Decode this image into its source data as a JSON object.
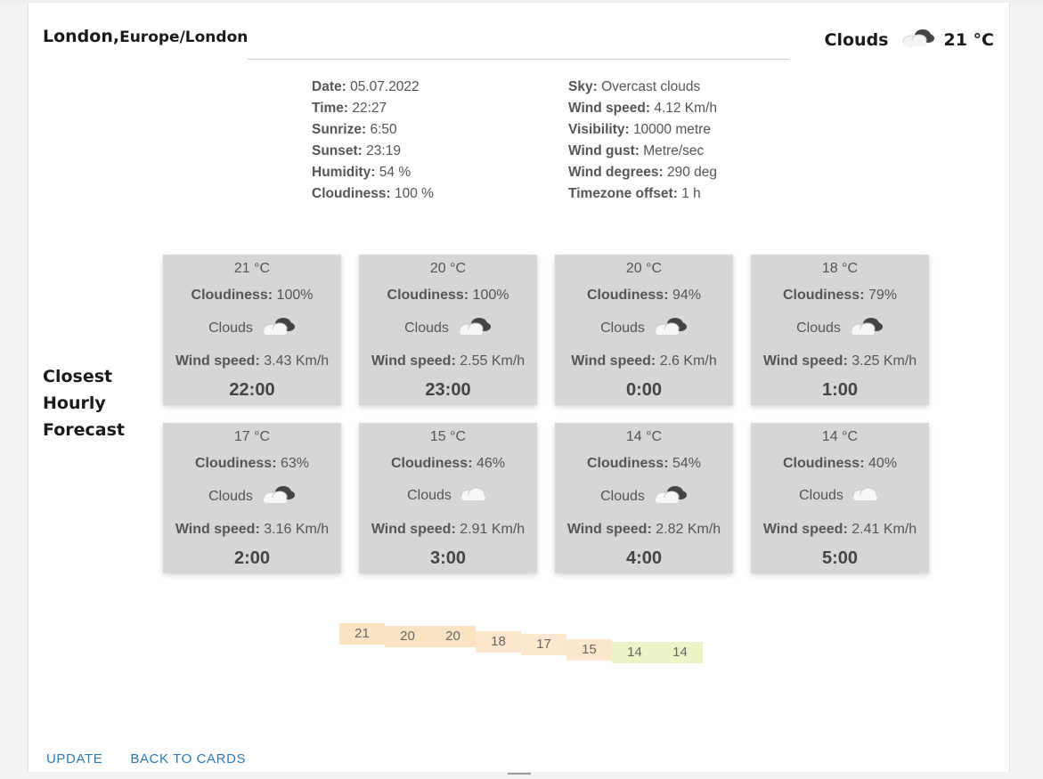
{
  "header": {
    "city": "London,",
    "zone": "Europe/London",
    "condition": "Clouds",
    "temperature": "21 °C",
    "icon": "cloud-dark-icon"
  },
  "details_left": [
    {
      "label": "Date:",
      "value": "05.07.2022"
    },
    {
      "label": "Time:",
      "value": "22:27"
    },
    {
      "label": "Sunrize:",
      "value": "6:50"
    },
    {
      "label": "Sunset:",
      "value": "23:19"
    },
    {
      "label": "Humidity:",
      "value": "54 %"
    },
    {
      "label": "Cloudiness:",
      "value": "100 %"
    }
  ],
  "details_right": [
    {
      "label": "Sky:",
      "value": "Overcast clouds"
    },
    {
      "label": "Wind speed:",
      "value": "4.12 Km/h"
    },
    {
      "label": "Visibility:",
      "value": "10000 metre"
    },
    {
      "label": "Wind gust:",
      "value": "Metre/sec"
    },
    {
      "label": "Wind degrees:",
      "value": "290 deg"
    },
    {
      "label": "Timezone offset:",
      "value": "1 h"
    }
  ],
  "forecast": {
    "title_lines": [
      "Closest",
      "Hourly",
      "Forecast"
    ],
    "cloudiness_label": "Cloudiness:",
    "wind_label": "Wind speed:",
    "cards": [
      {
        "temp": "21 °C",
        "cloudiness": "100%",
        "condition": "Clouds",
        "icon": "cloud-dark-icon",
        "wind": "3.43 Km/h",
        "hour": "22:00"
      },
      {
        "temp": "20 °C",
        "cloudiness": "100%",
        "condition": "Clouds",
        "icon": "cloud-dark-icon",
        "wind": "2.55 Km/h",
        "hour": "23:00"
      },
      {
        "temp": "20 °C",
        "cloudiness": "94%",
        "condition": "Clouds",
        "icon": "cloud-dark-icon",
        "wind": "2.6 Km/h",
        "hour": "0:00"
      },
      {
        "temp": "18 °C",
        "cloudiness": "79%",
        "condition": "Clouds",
        "icon": "cloud-dark-icon",
        "wind": "3.25 Km/h",
        "hour": "1:00"
      },
      {
        "temp": "17 °C",
        "cloudiness": "63%",
        "condition": "Clouds",
        "icon": "cloud-dark-icon",
        "wind": "3.16 Km/h",
        "hour": "2:00"
      },
      {
        "temp": "15 °C",
        "cloudiness": "46%",
        "condition": "Clouds",
        "icon": "cloud-light-icon",
        "wind": "2.91 Km/h",
        "hour": "3:00"
      },
      {
        "temp": "14 °C",
        "cloudiness": "54%",
        "condition": "Clouds",
        "icon": "cloud-dark-icon",
        "wind": "2.82 Km/h",
        "hour": "4:00"
      },
      {
        "temp": "14 °C",
        "cloudiness": "40%",
        "condition": "Clouds",
        "icon": "cloud-light-icon",
        "wind": "2.41 Km/h",
        "hour": "5:00"
      }
    ]
  },
  "temp_strip": {
    "values": [
      21,
      20,
      20,
      18,
      17,
      15,
      14,
      14
    ],
    "colors": [
      "#fbe3c2",
      "#fbe3c2",
      "#fbe3c2",
      "#fbe6cc",
      "#fbe8cf",
      "#fae7cc",
      "#eef3c6",
      "#eef3c6"
    ]
  },
  "footer": {
    "update_label": "UPDATE",
    "back_label": "BACK TO CARDS"
  }
}
